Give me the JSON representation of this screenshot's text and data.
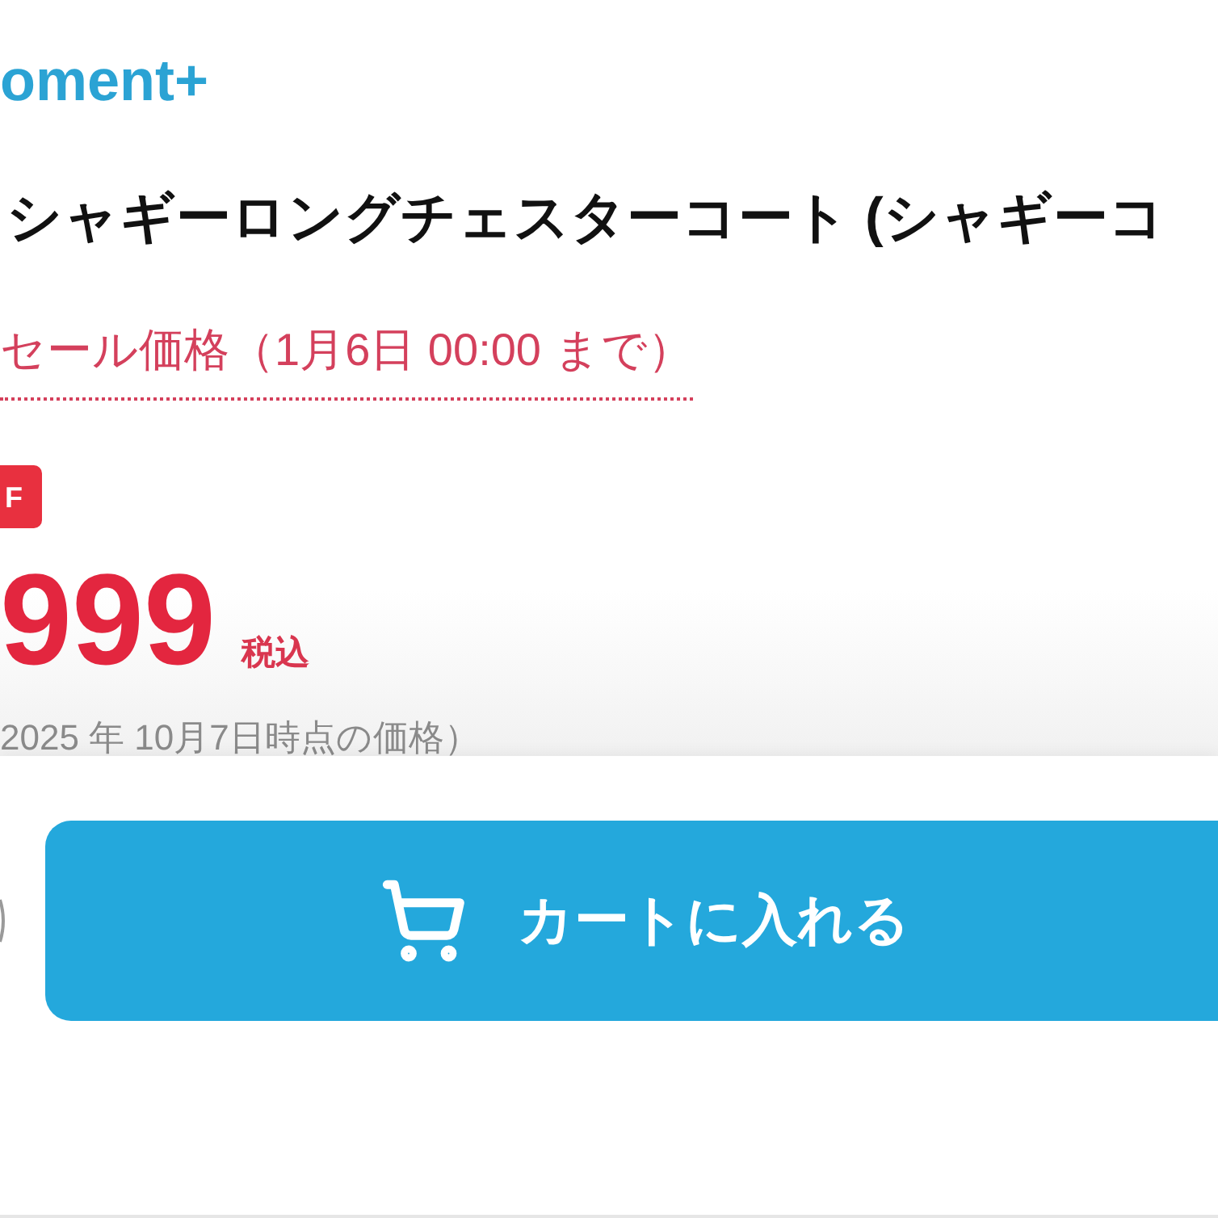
{
  "brand": {
    "text": "oment+"
  },
  "product": {
    "title": "シャギーロングチェスターコート (シャギーコ",
    "sale_label": "セール価格（1月6日 00:00 まで）",
    "badge": "F",
    "price": "999",
    "tax_note": "税込",
    "price_date_note": "2025 年 10月7日時点の価格）"
  },
  "actions": {
    "add_to_cart": "カートに入れる"
  }
}
